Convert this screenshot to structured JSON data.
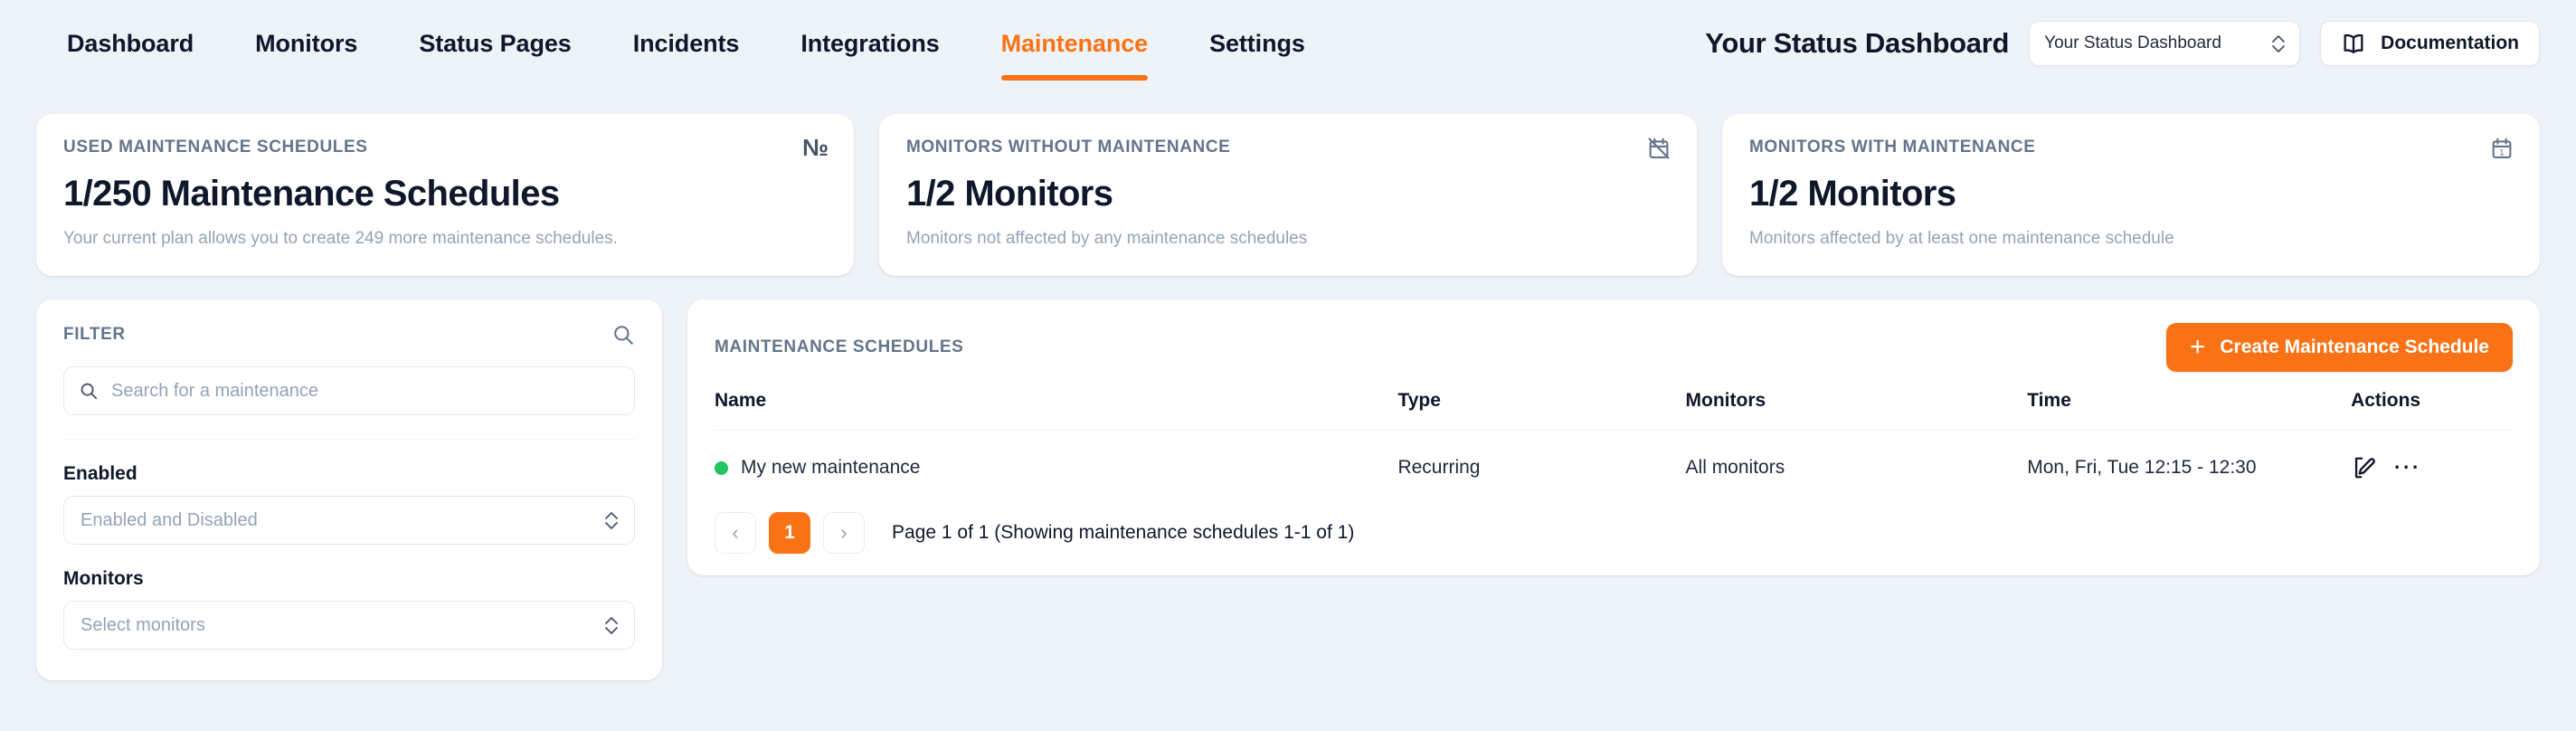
{
  "nav": {
    "items": [
      {
        "label": "Dashboard",
        "active": false
      },
      {
        "label": "Monitors",
        "active": false
      },
      {
        "label": "Status Pages",
        "active": false
      },
      {
        "label": "Incidents",
        "active": false
      },
      {
        "label": "Integrations",
        "active": false
      },
      {
        "label": "Maintenance",
        "active": true
      },
      {
        "label": "Settings",
        "active": false
      }
    ],
    "brand_title": "Your Status Dashboard",
    "workspace_select_value": "Your Status Dashboard",
    "documentation_label": "Documentation"
  },
  "stats": [
    {
      "label": "USED MAINTENANCE SCHEDULES",
      "value": "1/250 Maintenance Schedules",
      "description": "Your current plan allows you to create 249 more maintenance schedules.",
      "icon": "numero-icon"
    },
    {
      "label": "MONITORS WITHOUT MAINTENANCE",
      "value": "1/2 Monitors",
      "description": "Monitors not affected by any maintenance schedules",
      "icon": "calendar-off-icon"
    },
    {
      "label": "MONITORS WITH MAINTENANCE",
      "value": "1/2 Monitors",
      "description": "Monitors affected by at least one maintenance schedule",
      "icon": "calendar-icon"
    }
  ],
  "filter": {
    "title": "FILTER",
    "search_placeholder": "Search for a maintenance",
    "search_value": "",
    "enabled_label": "Enabled",
    "enabled_value": "Enabled and Disabled",
    "monitors_label": "Monitors",
    "monitors_value": "Select monitors"
  },
  "table": {
    "title": "MAINTENANCE SCHEDULES",
    "create_label": "Create Maintenance Schedule",
    "columns": {
      "name": "Name",
      "type": "Type",
      "monitors": "Monitors",
      "time": "Time",
      "actions": "Actions"
    },
    "rows": [
      {
        "status": "enabled",
        "name": "My new maintenance",
        "type": "Recurring",
        "monitors": "All monitors",
        "time": "Mon, Fri, Tue 12:15 - 12:30"
      }
    ]
  },
  "pagination": {
    "prev": "‹",
    "next": "›",
    "current_page": "1",
    "info": "Page 1 of 1 (Showing maintenance schedules 1-1 of 1)"
  },
  "colors": {
    "accent": "#f97316",
    "page_background": "#eef3f8",
    "card_background": "#ffffff",
    "status_enabled": "#22c55e",
    "muted_text": "#64748b"
  }
}
